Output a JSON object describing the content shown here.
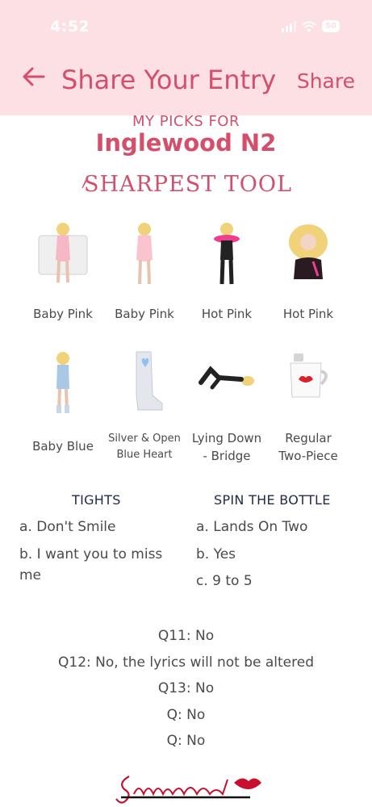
{
  "status": {
    "time": "4:52",
    "battery": "50"
  },
  "header": {
    "title": "Share Your Entry",
    "share_label": "Share"
  },
  "picks_for": "MY PICKS FOR",
  "venue": "Inglewood N2",
  "category": "SHARPEST TOOL",
  "items": [
    {
      "label": "Baby Pink",
      "icon": "outfit-doll-baby-pink-blanket"
    },
    {
      "label": "Baby Pink",
      "icon": "outfit-doll-baby-pink"
    },
    {
      "label": "Hot Pink",
      "icon": "outfit-doll-hot-pink-boa"
    },
    {
      "label": "Hot Pink",
      "icon": "outfit-doll-hot-pink-lace"
    },
    {
      "label": "Baby Blue",
      "icon": "outfit-doll-baby-blue"
    },
    {
      "label_line1": "Silver & Open",
      "label_line2": "Blue Heart",
      "icon": "silver-boots-icon"
    },
    {
      "label_line1": "Lying Down",
      "label_line2": "- Bridge",
      "icon": "lying-down-pose-icon"
    },
    {
      "label_line1": "Regular",
      "label_line2": "Two-Piece",
      "icon": "kiss-mug-icon"
    }
  ],
  "tights": {
    "heading": "TIGHTS",
    "a": "a. Don't Smile",
    "b_line1": "b. I want you to miss",
    "b_line2": "me"
  },
  "spin": {
    "heading": "SPIN THE BOTTLE",
    "a": "a. Lands On Two",
    "b": "b. Yes",
    "c": "c. 9 to 5"
  },
  "answers": [
    "Q11: No",
    "Q12: No, the lyrics will not be altered",
    "Q13: No",
    "Q: No",
    "Q: No"
  ],
  "signature": "Sabrinalert",
  "colors": {
    "accent": "#d34f6c",
    "header_bg": "#fde0e3",
    "heading_navy": "#1d2a4a",
    "text": "#4a4a4a"
  }
}
